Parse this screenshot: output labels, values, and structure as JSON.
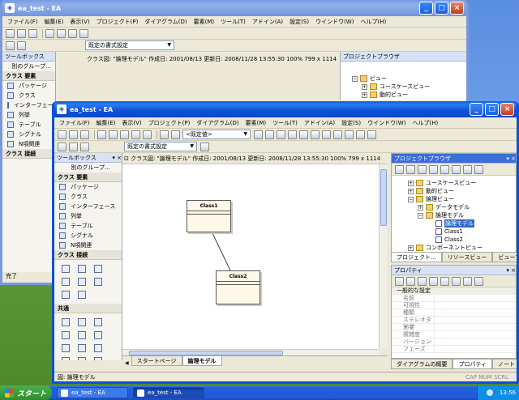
{
  "back_window": {
    "title": "ea_test - EA",
    "menus": [
      "ファイル(F)",
      "編集(E)",
      "表示(V)",
      "プロジェクト(P)",
      "ダイアグラム(D)",
      "要素(M)",
      "ツール(T)",
      "アドイン(A)",
      "設定(S)",
      "ウインドウ(W)",
      "ヘルプ(H)"
    ],
    "style_combo": "既定の書式設定",
    "toolbox_title": "ツールボックス",
    "toolbox_other": "別のグループ...",
    "groups": [
      {
        "title": "クラス 要素",
        "items": [
          "パッケージ",
          "クラス",
          "インターフェース",
          "列挙",
          "テーブル",
          "シグナル",
          "N項関連"
        ]
      },
      {
        "title": "クラス 接続"
      }
    ],
    "diagram_info": "クラス図: \"論理モデル\"  作成日: 2001/08/13  更新日: 2008/11/28 13:55:30  100%  799 x 1114",
    "project_browser": "プロジェクトブラウザ",
    "tree": [
      "ビュー",
      "ユースケースビュー",
      "動的ビュー"
    ],
    "status": "完了"
  },
  "front_window": {
    "title": "ea_test - EA",
    "menus": [
      "ファイル(F)",
      "編集(E)",
      "表示(V)",
      "プロジェクト(P)",
      "ダイアグラム(D)",
      "要素(M)",
      "ツール(T)",
      "アドイン(A)",
      "設定(S)",
      "ウインドウ(W)",
      "ヘルプ(H)"
    ],
    "default_combo": "<既定値>",
    "style_combo": "既定の書式設定",
    "toolbox_title": "ツールボックス",
    "toolbox_other": "別のグループ...",
    "group_elements": "クラス 要素",
    "element_items": [
      "パッケージ",
      "クラス",
      "インターフェース",
      "列挙",
      "テーブル",
      "シグナル",
      "N項関連"
    ],
    "group_connectors": "クラス 接続",
    "group_common": "共通",
    "diagram_info": "クラス図: \"論理モデル\"  作成日: 2001/08/13  更新日: 2008/11/28 13:55:30  100%  799 x 1114",
    "classes": [
      "Class1",
      "Class2"
    ],
    "tabs": [
      "スタートページ",
      "論理モデル"
    ],
    "project_browser": "プロジェクトブラウザ",
    "tree": [
      {
        "label": "ユースケースビュー",
        "level": 1,
        "icon": "folder"
      },
      {
        "label": "動的ビュー",
        "level": 1,
        "icon": "folder"
      },
      {
        "label": "論理ビュー",
        "level": 1,
        "icon": "folder"
      },
      {
        "label": "データモデル",
        "level": 2,
        "icon": "folder"
      },
      {
        "label": "論理モデル",
        "level": 2,
        "icon": "folder"
      },
      {
        "label": "論理モデル",
        "level": 3,
        "icon": "diagram",
        "selected": true
      },
      {
        "label": "Class1",
        "level": 3,
        "icon": "class"
      },
      {
        "label": "Class2",
        "level": 3,
        "icon": "class"
      },
      {
        "label": "コンポーネントビュー",
        "level": 1,
        "icon": "folder"
      }
    ],
    "browser_tabs": [
      "プロジェクト...",
      "リソースビュー",
      "ビューブラウザ"
    ],
    "properties_title": "プロパティ",
    "properties_section": "一般的な設定",
    "properties": [
      "名前",
      "可視性",
      "種類",
      "ステレオタイプ",
      "別名",
      "複雑度",
      "バージョン",
      "フェーズ"
    ],
    "bottom_tabs": [
      "ダイアグラムの概要",
      "プロパティ",
      "ノート"
    ],
    "status_left": "図: 論理モデル",
    "status_right": "CAP  NUM  SCRL"
  },
  "taskbar": {
    "start": "スタート",
    "tasks": [
      "ea_test - EA",
      "ea_test - EA"
    ],
    "clock": "13:56"
  }
}
